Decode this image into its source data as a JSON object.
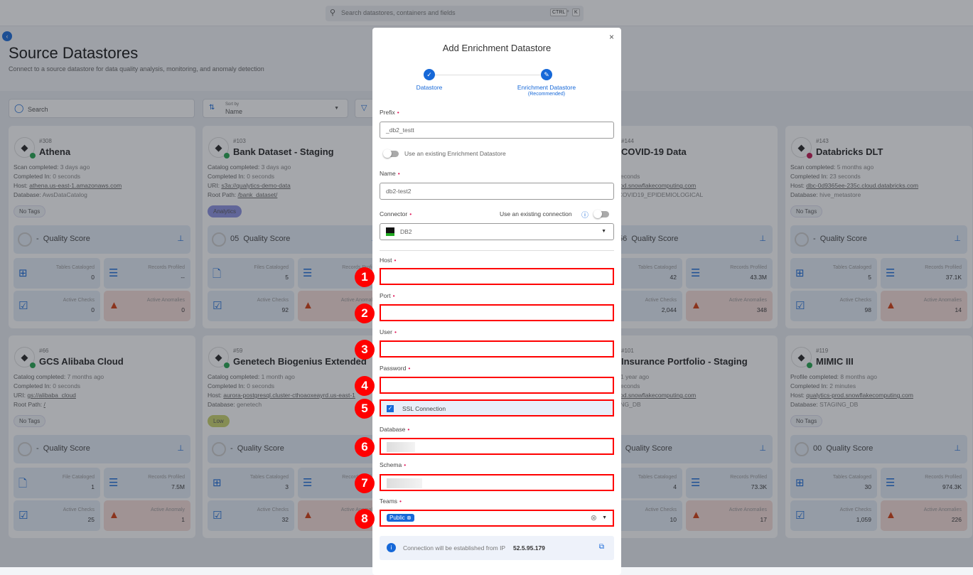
{
  "topbar": {
    "search_placeholder": "Search datastores, containers and fields",
    "kbd1": "CTRL",
    "plus": "+",
    "kbd2": "K"
  },
  "page": {
    "title": "Source Datastores",
    "subtitle": "Connect to a source datastore for data quality analysis, monitoring, and anomaly detection"
  },
  "controls": {
    "search_placeholder": "Search",
    "sort_label": "Sort by",
    "sort_value": "Name"
  },
  "cards": [
    {
      "id": "#308",
      "title": "Athena",
      "status": "green",
      "logo": "athena-logo",
      "meta": [
        [
          "Scan completed:",
          "3 days ago",
          false
        ],
        [
          "Completed In:",
          "0 seconds",
          false
        ],
        [
          "Host:",
          "athena.us-east-1.amazonaws.com",
          true
        ],
        [
          "Database:",
          "AwsDataCatalog",
          false
        ]
      ],
      "tag": "No Tags",
      "score": "-",
      "stats": [
        [
          "Tables Cataloged",
          "0"
        ],
        [
          "Records Profiled",
          "--"
        ],
        [
          "Active Checks",
          "0"
        ],
        [
          "Active Anomalies",
          "0"
        ]
      ]
    },
    {
      "id": "#103",
      "title": "Bank Dataset - Staging",
      "status": "green",
      "logo": "s3-logo",
      "meta": [
        [
          "Catalog completed:",
          "3 days ago",
          false
        ],
        [
          "Completed In:",
          "0 seconds",
          false
        ],
        [
          "URI:",
          "s3a://qualytics-demo-data",
          true
        ],
        [
          "Root Path:",
          "/bank_dataset/",
          true
        ]
      ],
      "tag": "Analytics",
      "tag_color": "#8a8fe0",
      "score": "05",
      "stats": [
        [
          "Files Cataloged",
          "5"
        ],
        [
          "Records Profiled",
          ""
        ],
        [
          "Active Checks",
          "92"
        ],
        [
          "Active Anomalies",
          ""
        ]
      ]
    },
    {
      "id": "#144",
      "title": "COVID-19 Data",
      "status": "green",
      "logo": "snowflake-logo",
      "meta": [
        [
          "",
          "ago",
          false
        ],
        [
          "ed In:",
          "0 seconds",
          false
        ],
        [
          "",
          "alytics-prod.snowflakecomputing.com",
          true
        ],
        [
          "e:",
          "PUB_COVID19_EPIDEMIOLOGICAL",
          false
        ]
      ],
      "tag": "",
      "score": "56",
      "stats": [
        [
          "Tables Cataloged",
          "42"
        ],
        [
          "Records Profiled",
          "43.3M"
        ],
        [
          "Active Checks",
          "2,044"
        ],
        [
          "Active Anomalies",
          "348"
        ]
      ]
    },
    {
      "id": "#143",
      "title": "Databricks DLT",
      "status": "red",
      "logo": "databricks-logo",
      "meta": [
        [
          "Scan completed:",
          "5 months ago",
          false
        ],
        [
          "Completed In:",
          "23 seconds",
          false
        ],
        [
          "Host:",
          "dbc-0d9365ee-235c.cloud.databricks.com",
          true
        ],
        [
          "Database:",
          "hive_metastore",
          false
        ]
      ],
      "tag": "No Tags",
      "score": "-",
      "stats": [
        [
          "Tables Cataloged",
          "5"
        ],
        [
          "Records Profiled",
          "37.1K"
        ],
        [
          "Active Checks",
          "98"
        ],
        [
          "Active Anomalies",
          "14"
        ]
      ]
    },
    {
      "id": "#66",
      "title": "GCS Alibaba Cloud",
      "status": "green",
      "logo": "gcs-logo",
      "meta": [
        [
          "Catalog completed:",
          "7 months ago",
          false
        ],
        [
          "Completed In:",
          "0 seconds",
          false
        ],
        [
          "URI:",
          "gs://alibaba_cloud",
          true
        ],
        [
          "Root Path:",
          "/",
          true
        ]
      ],
      "tag": "No Tags",
      "score": "-",
      "stats": [
        [
          "File Cataloged",
          "1"
        ],
        [
          "Records Profiled",
          "7.5M"
        ],
        [
          "Active Checks",
          "25"
        ],
        [
          "Active Anomaly",
          "1"
        ]
      ]
    },
    {
      "id": "#59",
      "title": "Genetech Biogenius Extended",
      "status": "green",
      "logo": "postgres-logo",
      "meta": [
        [
          "Catalog completed:",
          "1 month ago",
          false
        ],
        [
          "Completed In:",
          "0 seconds",
          false
        ],
        [
          "Host:",
          "aurora-postgresql.cluster-cthoaoxeayrd.us-east-1",
          true
        ],
        [
          "Database:",
          "genetech",
          false
        ]
      ],
      "tag": "Low",
      "tag_color": "#c8d26a",
      "score": "-",
      "stats": [
        [
          "Tables Cataloged",
          "3"
        ],
        [
          "Records Profiled",
          ""
        ],
        [
          "Active Checks",
          "32"
        ],
        [
          "Active Anomalies",
          ""
        ]
      ]
    },
    {
      "id": "#101",
      "title": "Insurance Portfolio - Staging",
      "status": "green",
      "logo": "snowflake-logo",
      "meta": [
        [
          "mpleted:",
          "1 year ago",
          false
        ],
        [
          "ed In:",
          "8 seconds",
          false
        ],
        [
          "",
          "alytics-prod.snowflakecomputing.com",
          true
        ],
        [
          "e:",
          "STAGING_DB",
          false
        ]
      ],
      "tag": "s",
      "score": "-",
      "stats": [
        [
          "Tables Cataloged",
          "4"
        ],
        [
          "Records Profiled",
          "73.3K"
        ],
        [
          "Active Checks",
          "10"
        ],
        [
          "Active Anomalies",
          "17"
        ]
      ]
    },
    {
      "id": "#119",
      "title": "MIMIC III",
      "status": "green",
      "logo": "snowflake-logo",
      "meta": [
        [
          "Profile completed:",
          "8 months ago",
          false
        ],
        [
          "Completed In:",
          "2 minutes",
          false
        ],
        [
          "Host:",
          "qualytics-prod.snowflakecomputing.com",
          true
        ],
        [
          "Database:",
          "STAGING_DB",
          false
        ]
      ],
      "tag": "No Tags",
      "score": "00",
      "stats": [
        [
          "Tables Cataloged",
          "30"
        ],
        [
          "Records Profiled",
          "974.3K"
        ],
        [
          "Active Checks",
          "1,059"
        ],
        [
          "Active Anomalies",
          "226"
        ]
      ]
    }
  ],
  "score_label": "Quality Score",
  "modal": {
    "title": "Add Enrichment Datastore",
    "close": "×",
    "steps": [
      {
        "label": "Datastore",
        "sub": ""
      },
      {
        "label": "Enrichment Datastore",
        "sub": "(Recommended)"
      }
    ],
    "prefix_label": "Prefix",
    "prefix_value": "_db2_testt",
    "use_existing_enrichment": "Use an existing Enrichment Datastore",
    "name_label": "Name",
    "name_value": "db2-test2",
    "connector_label": "Connector",
    "use_existing_connection": "Use an existing connection",
    "connector_value": "DB2",
    "host_label": "Host",
    "port_label": "Port",
    "user_label": "User",
    "password_label": "Password",
    "ssl_label": "SSL Connection",
    "ssl_checked": true,
    "database_label": "Database",
    "schema_label": "Schema",
    "teams_label": "Teams",
    "team_chip": "Public",
    "ip_note": "Connection will be established from IP",
    "ip": "52.5.95.179",
    "required": "•"
  },
  "badges": [
    "1",
    "2",
    "3",
    "4",
    "5",
    "6",
    "7",
    "8"
  ],
  "colors": {
    "accent": "#1668d8",
    "highlight": "#ff0000",
    "required": "#e0195a"
  }
}
